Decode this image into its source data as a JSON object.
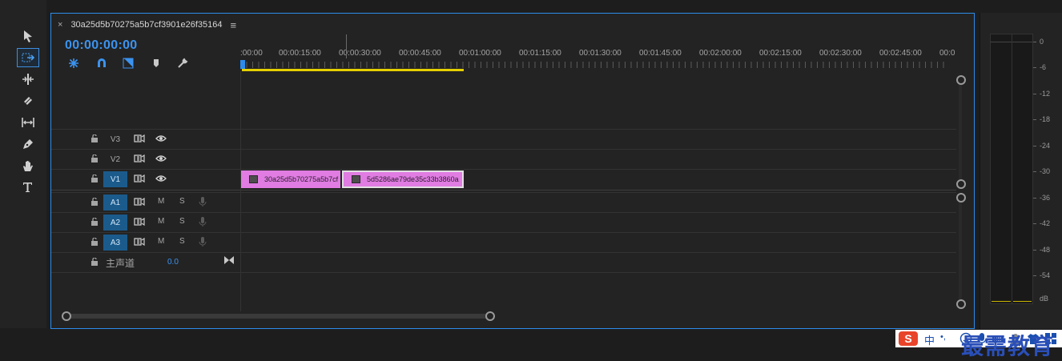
{
  "tools": [
    {
      "name": "selection-tool-icon"
    },
    {
      "name": "track-select-forward-tool-icon",
      "selected": true
    },
    {
      "name": "ripple-edit-tool-icon"
    },
    {
      "name": "razor-tool-icon"
    },
    {
      "name": "slip-tool-icon"
    },
    {
      "name": "pen-tool-icon"
    },
    {
      "name": "hand-tool-icon"
    },
    {
      "name": "type-tool-icon"
    }
  ],
  "sequence": {
    "tab_close": "×",
    "name": "30a25d5b70275a5b7cf3901e26f35164",
    "menu": "≡",
    "timecode": "00:00:00:00"
  },
  "ruler": {
    "labels": [
      ":00:00",
      "00:00:15:00",
      "00:00:30:00",
      "00:00:45:00",
      "00:01:00:00",
      "00:01:15:00",
      "00:01:30:00",
      "00:01:45:00",
      "00:02:00:00",
      "00:02:15:00",
      "00:02:30:00",
      "00:02:45:00",
      "00:0"
    ],
    "playhead_position": 0
  },
  "video_tracks": [
    {
      "name": "V3",
      "active": false
    },
    {
      "name": "V2",
      "active": false
    },
    {
      "name": "V1",
      "active": true
    }
  ],
  "audio_tracks": [
    {
      "name": "A1",
      "m": "M",
      "s": "S"
    },
    {
      "name": "A2",
      "m": "M",
      "s": "S"
    },
    {
      "name": "A3",
      "m": "M",
      "s": "S"
    }
  ],
  "master": {
    "label": "主声道",
    "value": "0.0"
  },
  "clips": [
    {
      "label": "30a25d5b70275a5b7cf"
    },
    {
      "label": "5d5286ae79de35c33b3860a"
    }
  ],
  "meter": {
    "scale": [
      "0",
      "-6",
      "-12",
      "-18",
      "-24",
      "-30",
      "-36",
      "-42",
      "-48",
      "-54",
      "dB"
    ]
  },
  "colors": {
    "accent": "#2d8ceb",
    "clip": "#e07ce2",
    "work_area": "#e5d000"
  },
  "watermark": "最需教育",
  "tray": {
    "ime_label": "中",
    "ime_punct": "•,"
  }
}
